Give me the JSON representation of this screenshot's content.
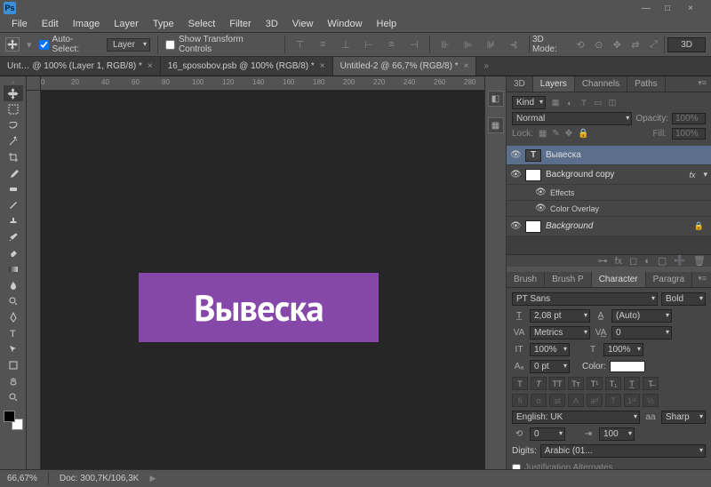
{
  "app": {
    "logo_text": "Ps"
  },
  "window_controls": {
    "min": "—",
    "max": "□",
    "close": "×"
  },
  "menu": [
    "File",
    "Edit",
    "Image",
    "Layer",
    "Type",
    "Select",
    "Filter",
    "3D",
    "View",
    "Window",
    "Help"
  ],
  "options": {
    "auto_select": "Auto-Select:",
    "auto_select_mode": "Layer",
    "show_transform": "Show Transform Controls",
    "mode3d_label": "3D Mode:",
    "mode3d_btn": "3D"
  },
  "tabs": [
    {
      "label": "Unt… @ 100% (Layer 1, RGB/8) *",
      "active": false
    },
    {
      "label": "16_sposobov.psb @ 100% (RGB/8) *",
      "active": false
    },
    {
      "label": "Untitled-2 @ 66,7% (RGB/8) *",
      "active": true
    }
  ],
  "ruler_ticks": [
    "0",
    "20",
    "40",
    "60",
    "80",
    "100",
    "120",
    "140",
    "160",
    "180",
    "200",
    "220",
    "240",
    "260",
    "280"
  ],
  "canvas": {
    "text": "Вывеска",
    "bg_color": "#8548a8",
    "text_color": "#ffffff"
  },
  "panels": {
    "layers_tabs": [
      "3D",
      "Layers",
      "Channels",
      "Paths"
    ],
    "layers_active": "Layers",
    "kind_label": "Kind",
    "blend_mode": "Normal",
    "opacity_label": "Opacity:",
    "opacity_value": "100%",
    "lock_label": "Lock:",
    "fill_label": "Fill:",
    "fill_value": "100%",
    "layers": [
      {
        "name": "Вывеска",
        "type": "text",
        "visible": true,
        "selected": true
      },
      {
        "name": "Background copy",
        "type": "raster",
        "visible": true,
        "fx": "fx"
      },
      {
        "name": "Effects",
        "type": "sub",
        "visible": true
      },
      {
        "name": "Color Overlay",
        "type": "sub",
        "visible": true
      },
      {
        "name": "Background",
        "type": "raster",
        "visible": true,
        "locked": true
      }
    ],
    "char_tabs": [
      "Brush",
      "Brush P",
      "Character",
      "Paragra"
    ],
    "char_active": "Character",
    "font_family": "PT Sans",
    "font_style": "Bold",
    "font_size": "2,08 pt",
    "leading": "(Auto)",
    "kerning": "Metrics",
    "tracking": "0",
    "vscale": "100%",
    "hscale": "100%",
    "baseline": "0 pt",
    "color_label": "Color:",
    "language": "English: UK",
    "aa_label": "aa",
    "aa_mode": "Sharp",
    "angle": "0",
    "spread": "100",
    "digits_label": "Digits:",
    "digits_value": "Arabic (01...",
    "justification": "Justification Alternates"
  },
  "status": {
    "zoom": "66,67%",
    "doc": "Doc: 300,7K/106,3K"
  }
}
